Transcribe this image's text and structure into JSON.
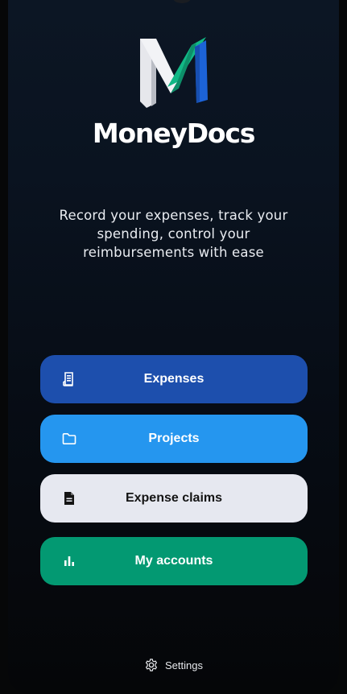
{
  "app": {
    "brand_name": "MoneyDocs",
    "tagline": "Record your expenses, track your spending, control your reimbursements with ease"
  },
  "logo": {
    "icon": "moneydocs-logo-icon",
    "colors": {
      "letter": "#e8e8ec",
      "accent_green": "#12b886",
      "accent_blue": "#1c63d8"
    }
  },
  "menu": {
    "items": [
      {
        "label": "Expenses",
        "icon": "receipt-icon",
        "color": "#1d4fad"
      },
      {
        "label": "Projects",
        "icon": "folder-icon",
        "color": "#2596ef"
      },
      {
        "label": "Expense claims",
        "icon": "document-icon",
        "color": "#e6e8f0"
      },
      {
        "label": "My accounts",
        "icon": "bar-chart-icon",
        "color": "#039972"
      }
    ]
  },
  "footer": {
    "settings_label": "Settings",
    "settings_icon": "gear-icon"
  }
}
